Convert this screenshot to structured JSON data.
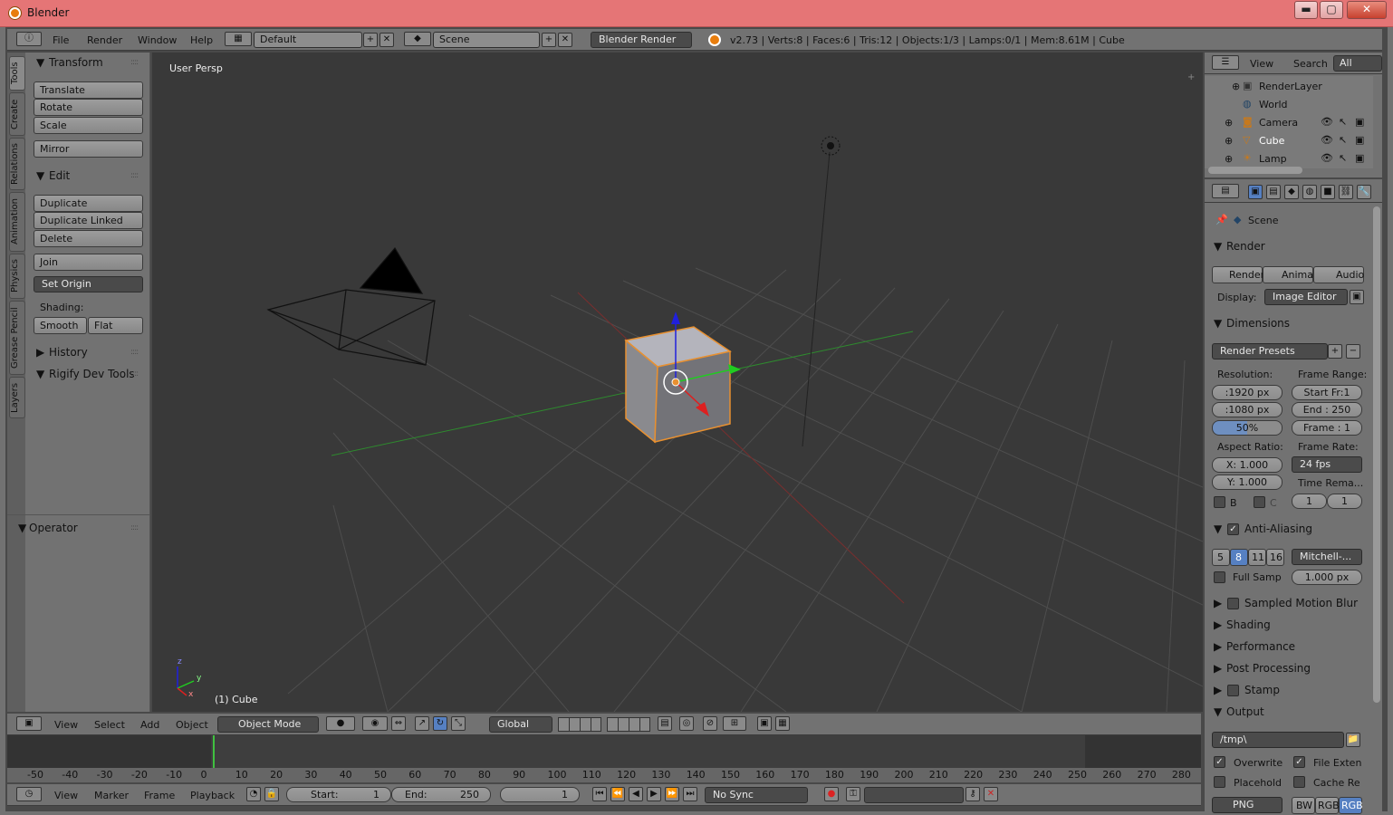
{
  "window": {
    "title": "Blender",
    "minimize": "▬",
    "maximize": "▢",
    "close": "✕"
  },
  "info_bar": {
    "menus": [
      "File",
      "Render",
      "Window",
      "Help"
    ],
    "layout": "Default",
    "scene": "Scene",
    "engine": "Blender Render",
    "stats": "v2.73 | Verts:8 | Faces:6 | Tris:12 | Objects:1/3 | Lamps:0/1 | Mem:8.61M | Cube"
  },
  "tool_tabs": [
    "Tools",
    "Create",
    "Relations",
    "Animation",
    "Physics",
    "Grease Pencil",
    "Layers"
  ],
  "tool_shelf": {
    "transform": {
      "title": "Transform",
      "buttons": [
        "Translate",
        "Rotate",
        "Scale"
      ],
      "mirror": "Mirror"
    },
    "edit": {
      "title": "Edit",
      "buttons": [
        "Duplicate",
        "Duplicate Linked",
        "Delete"
      ],
      "join": "Join",
      "set_origin": "Set Origin",
      "shading_label": "Shading:",
      "smooth": "Smooth",
      "flat": "Flat"
    },
    "history": "History",
    "rigify": "Rigify Dev Tools",
    "operator": "Operator"
  },
  "viewport": {
    "view_label": "User Persp",
    "object_label": "(1) Cube",
    "axis_x": "x",
    "axis_y": "y",
    "axis_z": "z"
  },
  "view3d_header": {
    "menus": [
      "View",
      "Select",
      "Add",
      "Object"
    ],
    "mode": "Object Mode",
    "orientation": "Global"
  },
  "outliner": {
    "view": "View",
    "search": "Search",
    "filter": "All Scenes",
    "items": [
      {
        "name": "RenderLayer",
        "icon": "render-layer-icon"
      },
      {
        "name": "World",
        "icon": "world-icon"
      },
      {
        "name": "Camera",
        "icon": "camera-icon"
      },
      {
        "name": "Cube",
        "icon": "mesh-icon"
      },
      {
        "name": "Lamp",
        "icon": "lamp-icon"
      }
    ]
  },
  "properties": {
    "context": "Scene",
    "render": {
      "title": "Render",
      "render_btn": "Render",
      "anim_btn": "Animat",
      "audio_btn": "Audio",
      "display_label": "Display:",
      "display_value": "Image Editor"
    },
    "dimensions": {
      "title": "Dimensions",
      "presets": "Render Presets",
      "resolution_label": "Resolution:",
      "res_x": ":1920 px",
      "res_y": ":1080 px",
      "res_pct": "50%",
      "frame_range_label": "Frame Range:",
      "start": "Start Fr:1",
      "end": "End : 250",
      "frame": "Frame : 1",
      "aspect_label": "Aspect Ratio:",
      "asp_x": "X:  1.000",
      "asp_y": "Y:  1.000",
      "frame_rate_label": "Frame Rate:",
      "fps": "24 fps",
      "time_remap": "Time Rema...",
      "b_label": "B",
      "c_label": "C",
      "tr_old": "1",
      "tr_new": "1"
    },
    "antialiasing": {
      "title": "Anti-Aliasing",
      "samples": [
        "5",
        "8",
        "11",
        "16"
      ],
      "selected": "8",
      "filter": "Mitchell-...",
      "full_samp": "Full Samp",
      "size": "1.000 px"
    },
    "collapsed": [
      "Sampled Motion Blur",
      "Shading",
      "Performance",
      "Post Processing",
      "Stamp"
    ],
    "output": {
      "title": "Output",
      "path": "/tmp\\",
      "overwrite": "Overwrite",
      "file_ext": "File Exten",
      "placeholders": "Placehold",
      "cache": "Cache Re",
      "format": "PNG",
      "bw": "BW",
      "rgb": "RGB",
      "rgba": "RGB"
    }
  },
  "timeline": {
    "ruler": [
      "-50",
      "-40",
      "-30",
      "-20",
      "-10",
      "0",
      "10",
      "20",
      "30",
      "40",
      "50",
      "60",
      "70",
      "80",
      "90",
      "100",
      "110",
      "120",
      "130",
      "140",
      "150",
      "160",
      "170",
      "180",
      "190",
      "200",
      "210",
      "220",
      "230",
      "240",
      "250",
      "260",
      "270",
      "280"
    ],
    "menus": [
      "View",
      "Marker",
      "Frame",
      "Playback"
    ],
    "start_label": "Start:",
    "start_val": "1",
    "end_label": "End:",
    "end_val": "250",
    "current": "1",
    "sync": "No Sync"
  }
}
